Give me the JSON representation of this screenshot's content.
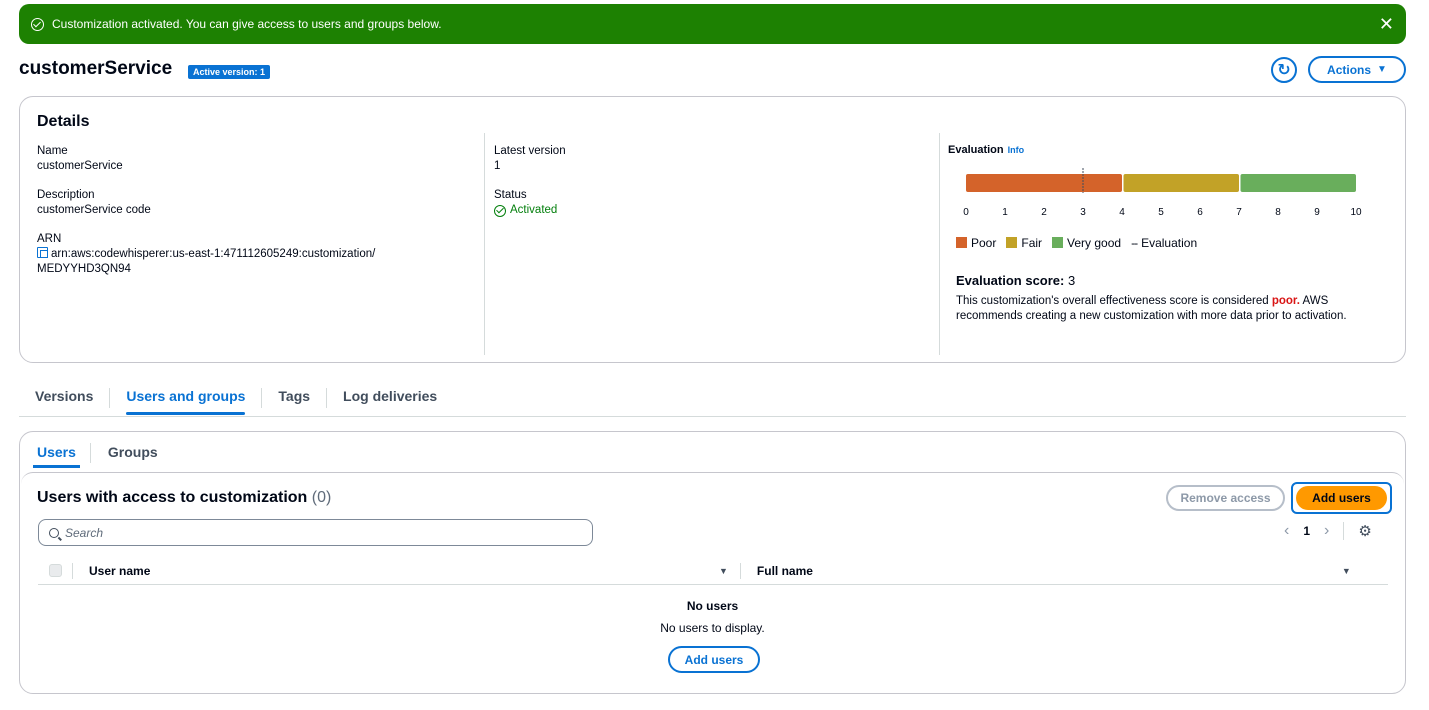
{
  "flash": {
    "message": "Customization activated. You can give access to users and groups below.",
    "close": "✕"
  },
  "header": {
    "title": "customerService",
    "badge": "Active version: 1",
    "refresh_icon": "↻",
    "actions_label": "Actions",
    "caret": "▼"
  },
  "details": {
    "heading": "Details",
    "name_label": "Name",
    "name_value": "customerService",
    "description_label": "Description",
    "description_value": "customerService code",
    "arn_label": "ARN",
    "arn_value_line1": "arn:aws:codewhisperer:us-east-1:471112605249:customization/",
    "arn_value_line2": "MEDYYHD3QN94",
    "latest_version_label": "Latest version",
    "latest_version_value": "1",
    "status_label": "Status",
    "status_value": "Activated"
  },
  "evaluation": {
    "title": "Evaluation",
    "info": "Info",
    "ticks": [
      "0",
      "1",
      "2",
      "3",
      "4",
      "5",
      "6",
      "7",
      "8",
      "9",
      "10"
    ],
    "segments": [
      {
        "name": "Poor",
        "from": 0,
        "to": 4,
        "color": "#d4632a"
      },
      {
        "name": "Fair",
        "from": 4,
        "to": 7,
        "color": "#c2a227"
      },
      {
        "name": "Very good",
        "from": 7,
        "to": 10,
        "color": "#69ae5c"
      }
    ],
    "marker": 3,
    "legend": {
      "poor": "Poor",
      "fair": "Fair",
      "very_good": "Very good",
      "evaluation": "Evaluation"
    },
    "score_label": "Evaluation score:",
    "score_value": "3",
    "desc_before": "This customization's overall effectiveness score is considered ",
    "desc_poor": "poor.",
    "desc_after": " AWS recommends creating a new customization with more data prior to activation."
  },
  "tabs": [
    "Versions",
    "Users and groups",
    "Tags",
    "Log deliveries"
  ],
  "subtabs": [
    "Users",
    "Groups"
  ],
  "users_panel": {
    "title": "Users with access to customization",
    "count": "(0)",
    "remove_label": "Remove access",
    "add_label": "Add users",
    "search_placeholder": "Search",
    "page": "1",
    "prev": "‹",
    "next": "›",
    "settings_icon": "⚙",
    "col_username": "User name",
    "col_fullname": "Full name",
    "sort_icon": "▼",
    "empty_title": "No users",
    "empty_sub": "No users to display.",
    "empty_button": "Add users"
  }
}
